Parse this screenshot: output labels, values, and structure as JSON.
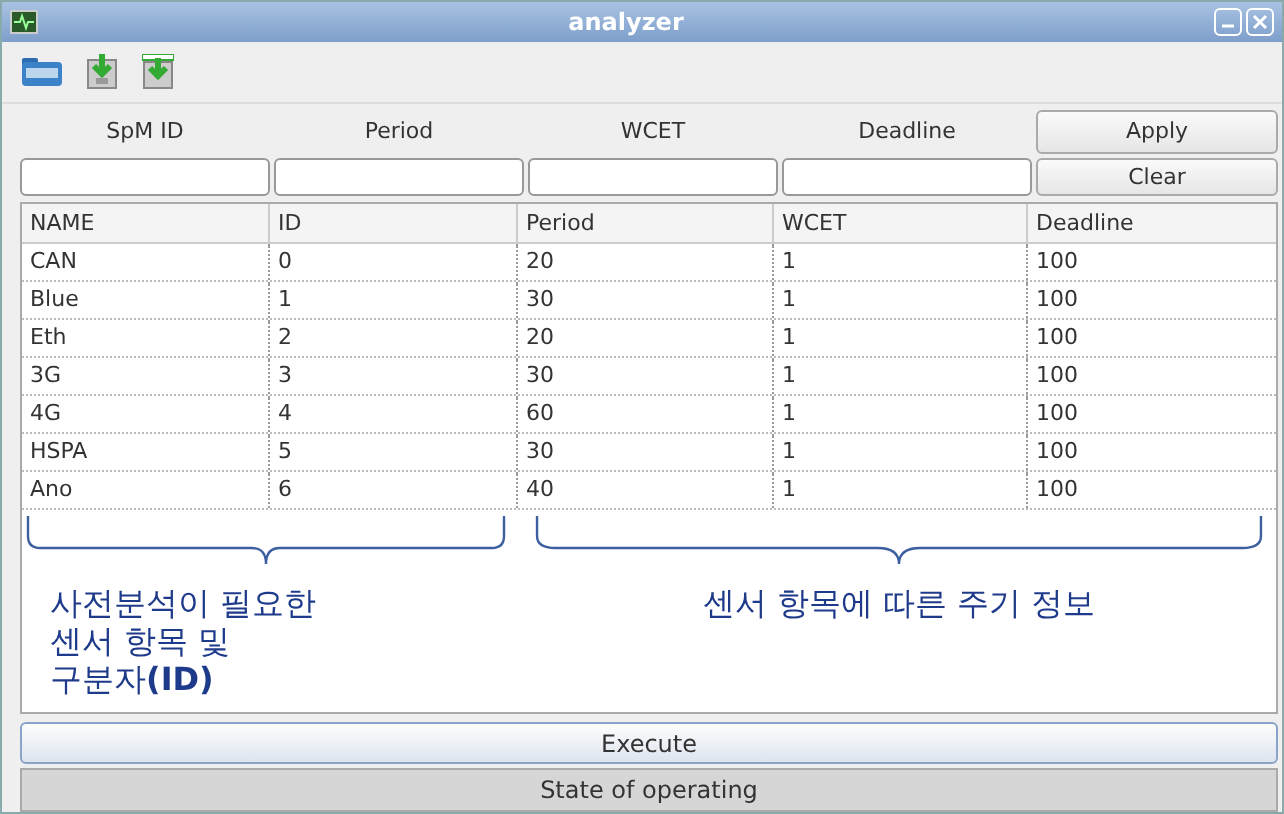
{
  "window": {
    "title": "analyzer"
  },
  "filter": {
    "labels": [
      "SpM ID",
      "Period",
      "WCET",
      "Deadline"
    ],
    "apply": "Apply",
    "clear": "Clear"
  },
  "table": {
    "columns": [
      "NAME",
      "ID",
      "Period",
      "WCET",
      "Deadline"
    ],
    "rows": [
      [
        "CAN",
        "0",
        "20",
        "1",
        "100"
      ],
      [
        "Blue",
        "1",
        "30",
        "1",
        "100"
      ],
      [
        "Eth",
        "2",
        "20",
        "1",
        "100"
      ],
      [
        "3G",
        "3",
        "30",
        "1",
        "100"
      ],
      [
        "4G",
        "4",
        "60",
        "1",
        "100"
      ],
      [
        "HSPA",
        "5",
        "30",
        "1",
        "100"
      ],
      [
        "Ano",
        "6",
        "40",
        "1",
        "100"
      ]
    ]
  },
  "annotations": [
    {
      "text": "사전분석이 필요한\n센서 항목 및\n구분자**(ID)**"
    },
    {
      "text": "센서 항목에 따른 주기 정보"
    }
  ],
  "execute": "Execute",
  "status_bar": "State of operating"
}
